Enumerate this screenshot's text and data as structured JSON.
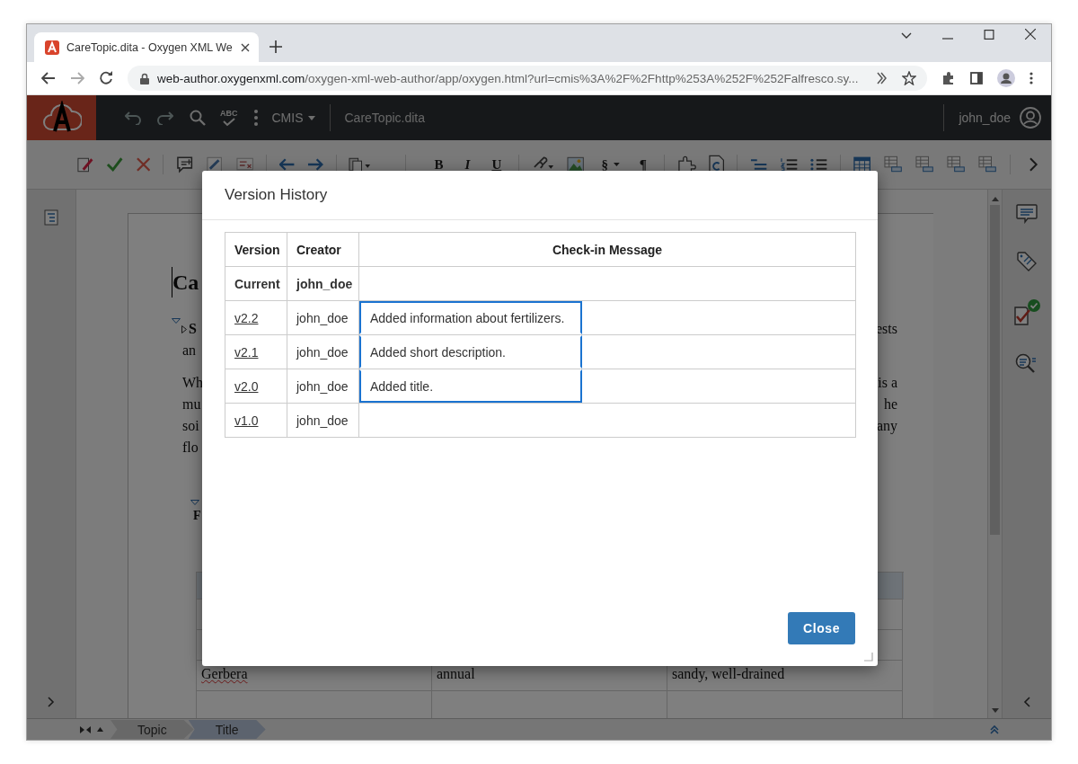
{
  "browser": {
    "tab_title": "CareTopic.dita - Oxygen XML We",
    "url_host": "web-author.oxygenxml.com",
    "url_path": "/oxygen-xml-web-author/app/oxygen.html?url=cmis%3A%2F%2Fhttp%253A%252F%252Falfresco.sy..."
  },
  "app_header": {
    "spell_label": "ABC",
    "menu": "CMIS",
    "file_name": "CareTopic.dita",
    "user": "john_doe"
  },
  "toolbar": {
    "text_buttons": [
      "B",
      "I",
      "U",
      "§",
      "¶"
    ]
  },
  "document": {
    "heading": "Ca",
    "shortdesc": [
      {
        "left": "S",
        "right": "ests"
      },
      {
        "left": "an"
      }
    ],
    "paragraph": [
      {
        "left": "Wh",
        "right": "is a"
      },
      {
        "left": "mu",
        "right": "he"
      },
      {
        "left": "soi",
        "right": "any"
      },
      {
        "left": "flo"
      }
    ],
    "section_title": "F",
    "table_rows": [
      [
        "Gerbera",
        "annual",
        "sandy, well-drained"
      ]
    ]
  },
  "breadcrumb": [
    {
      "label": "Topic",
      "selected": false
    },
    {
      "label": "Title",
      "selected": true
    }
  ],
  "dialog": {
    "title": "Version History",
    "columns": [
      "Version",
      "Creator",
      "Check-in Message"
    ],
    "rows": [
      {
        "kind": "current",
        "version": "Current",
        "creator": "john_doe",
        "selected": false
      },
      {
        "kind": "link",
        "version": "v2.2",
        "creator": "john_doe",
        "message": "Added information about fertilizers.",
        "selected": true
      },
      {
        "kind": "link",
        "version": "v2.1",
        "creator": "john_doe",
        "message": "Added short description.",
        "selected": true
      },
      {
        "kind": "link",
        "version": "v2.0",
        "creator": "john_doe",
        "message": "Added title.",
        "selected": true
      },
      {
        "kind": "link",
        "version": "v1.0",
        "creator": "john_doe",
        "selected": false
      }
    ],
    "close_button": "Close"
  }
}
